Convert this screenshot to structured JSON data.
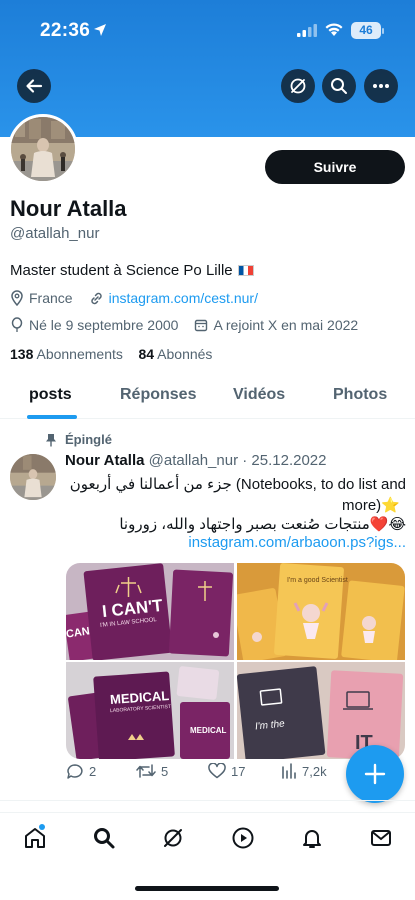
{
  "status_bar": {
    "time": "22:36",
    "battery": "46"
  },
  "header": {
    "back_icon": "arrow-left-icon",
    "grok_icon": "grok-icon",
    "search_icon": "search-icon",
    "more_icon": "more-icon"
  },
  "profile": {
    "follow_label": "Suivre",
    "name": "Nour Atalla",
    "handle": "@atallah_nur",
    "bio": "Master student à Science Po Lille",
    "location": "France",
    "website": "instagram.com/cest.nur/",
    "birthday": "Né le 9 septembre 2000",
    "joined": "A rejoint X en mai 2022",
    "following_count": "138",
    "following_label": "Abonnements",
    "followers_count": "84",
    "followers_label": "Abonnés"
  },
  "tabs": [
    {
      "label": "posts"
    },
    {
      "label": "Réponses"
    },
    {
      "label": "Vidéos"
    },
    {
      "label": "Photos"
    }
  ],
  "pinned_tweet": {
    "pinned_label": "Épinglé",
    "author_name": "Nour Atalla",
    "author_handle": "@atallah_nur",
    "date": "· 25.12.2022",
    "line1": "جزء من أعمالنا في أربعون (Notebooks, to do list and",
    "line2": "more)⭐",
    "line3": "منتجات صُنعت بصبر واجتهاد والله، زورونا❤️😂",
    "link": "instagram.com/arbaoon.ps?igs...",
    "images": [
      {
        "caption_main": "I CAN'T",
        "caption_sub": "I'M IN LAW SCHOOL",
        "side": "CAN"
      },
      {
        "caption_main": "I'm a good Scientist",
        "caption_sub": ""
      },
      {
        "caption_main": "MEDICAL",
        "caption_sub": "LABORATORY SCIENTIST",
        "side": "MEDICAL"
      },
      {
        "caption_main": "I'm the",
        "caption_sub": "IT"
      }
    ],
    "replies": "2",
    "retweets": "5",
    "likes": "17",
    "views": "7,2k"
  },
  "bottom_nav": {
    "items": [
      "home-icon",
      "search-icon",
      "grok-icon",
      "video-icon",
      "notifications-icon",
      "messages-icon"
    ]
  },
  "colors": {
    "accent": "#1d9bf0",
    "banner": "#2a93ea",
    "text": "#0f1419",
    "muted": "#536471"
  }
}
